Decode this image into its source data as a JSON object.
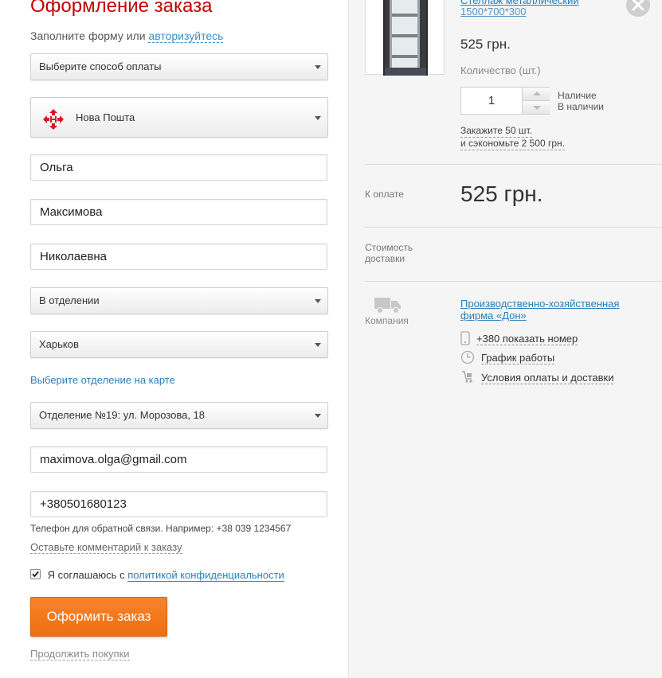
{
  "form": {
    "title": "Оформление заказа",
    "subtitle_text": "Заполните форму или",
    "login_link": "авторизуйтесь",
    "payment_select": "Выберите способ оплаты",
    "delivery_select": "Нова Пошта",
    "first_name": "Ольга",
    "last_name": "Максимова",
    "middle_name": "Николаевна",
    "delivery_type": "В отделении",
    "city": "Харьков",
    "map_link": "Выберите отделение на карте",
    "branch": "Отделение №19: ул. Морозова, 18",
    "email": "maximova.olga@gmail.com",
    "phone": "+380501680123",
    "phone_hint": "Телефон для обратной связи. Например: +38 039 1234567",
    "comment_link": "Оставьте комментарий к заказу",
    "agree_text": "Я соглашаюсь с",
    "privacy_link": "политикой конфиденциальности",
    "agree_checked": true,
    "submit_label": "Оформить заказ",
    "continue_link": "Продолжить покупки"
  },
  "product": {
    "name_line1": "Стеллаж металлический",
    "name_line2": "1500*700*300",
    "price": "525 грн.",
    "qty_label": "Количество (шт.)",
    "qty": "1",
    "availability_label": "Наличие",
    "availability_value": "В наличии",
    "promo_line1": "Закажите 50 шт.",
    "promo_line2": "и сэкономьте 2 500 грн."
  },
  "summary": {
    "to_pay_label": "К оплате",
    "to_pay_value": "525 грн.",
    "delivery_cost_line1": "Стоимость",
    "delivery_cost_line2": "доставки",
    "company_label": "Компания",
    "company_name_line1": "Производственно-хозяйственная",
    "company_name_line2": "фирма «Дон»",
    "phone_link": "+380 показать номер",
    "schedule_link": "График работы",
    "terms_link": "Условия оплаты и доставки"
  },
  "colors": {
    "title_red": "#c40000",
    "link_blue": "#2a7fb8",
    "order_orange": "#f27b1e",
    "nova_poshta_red": "#d7191f"
  }
}
